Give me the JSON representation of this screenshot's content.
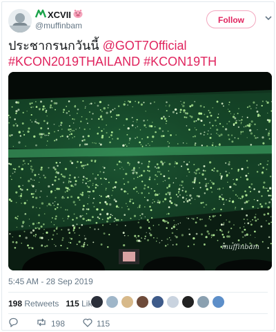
{
  "user": {
    "display_name": "XCVII",
    "handle": "@muffinbam"
  },
  "follow_label": "Follow",
  "tweet": {
    "text_plain": "ประชากรนกวันนี้ ",
    "mention": "@GOT7Official",
    "hashtag_1": "#KCON2019THAILAND",
    "hashtag_2": "#KCON19TH"
  },
  "photo": {
    "watermark": "muffinbam"
  },
  "timestamp": "5:45 AM - 28 Sep 2019",
  "stats": {
    "retweets_count": "198",
    "retweets_label": "Retweets",
    "likes_count": "115",
    "likes_label": "Likes"
  },
  "actions": {
    "retweet_count": "198",
    "like_count": "115"
  },
  "colors": {
    "accent": "#e0245e",
    "text": "#14171a",
    "muted": "#657786"
  }
}
